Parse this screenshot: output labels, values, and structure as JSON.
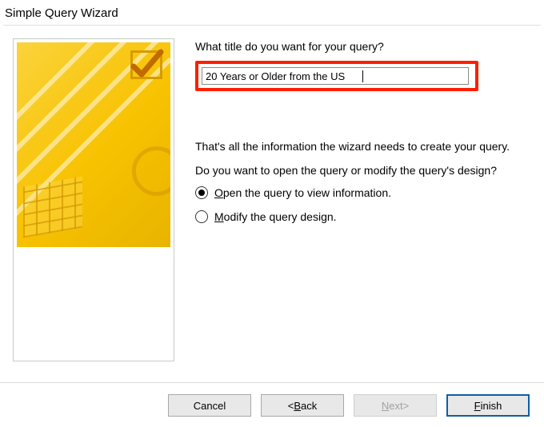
{
  "dialog": {
    "title": "Simple Query Wizard"
  },
  "main": {
    "title_prompt": "What title do you want for your query?",
    "title_value": "20 Years or Older from the US",
    "info_line1": "That's all the information the wizard needs to create your query.",
    "info_line2": "Do you want to open the query or modify the query's design?",
    "option_open": "Open the query to view information.",
    "option_modify": "Modify the query design.",
    "selected_option": "open"
  },
  "buttons": {
    "cancel": "Cancel",
    "back_prefix": "< ",
    "back_label": "Back",
    "next_label": "Next",
    "next_suffix": " >",
    "finish": "Finish"
  },
  "icons": {
    "wizard_art": "query-wizard-checkmark-art"
  }
}
